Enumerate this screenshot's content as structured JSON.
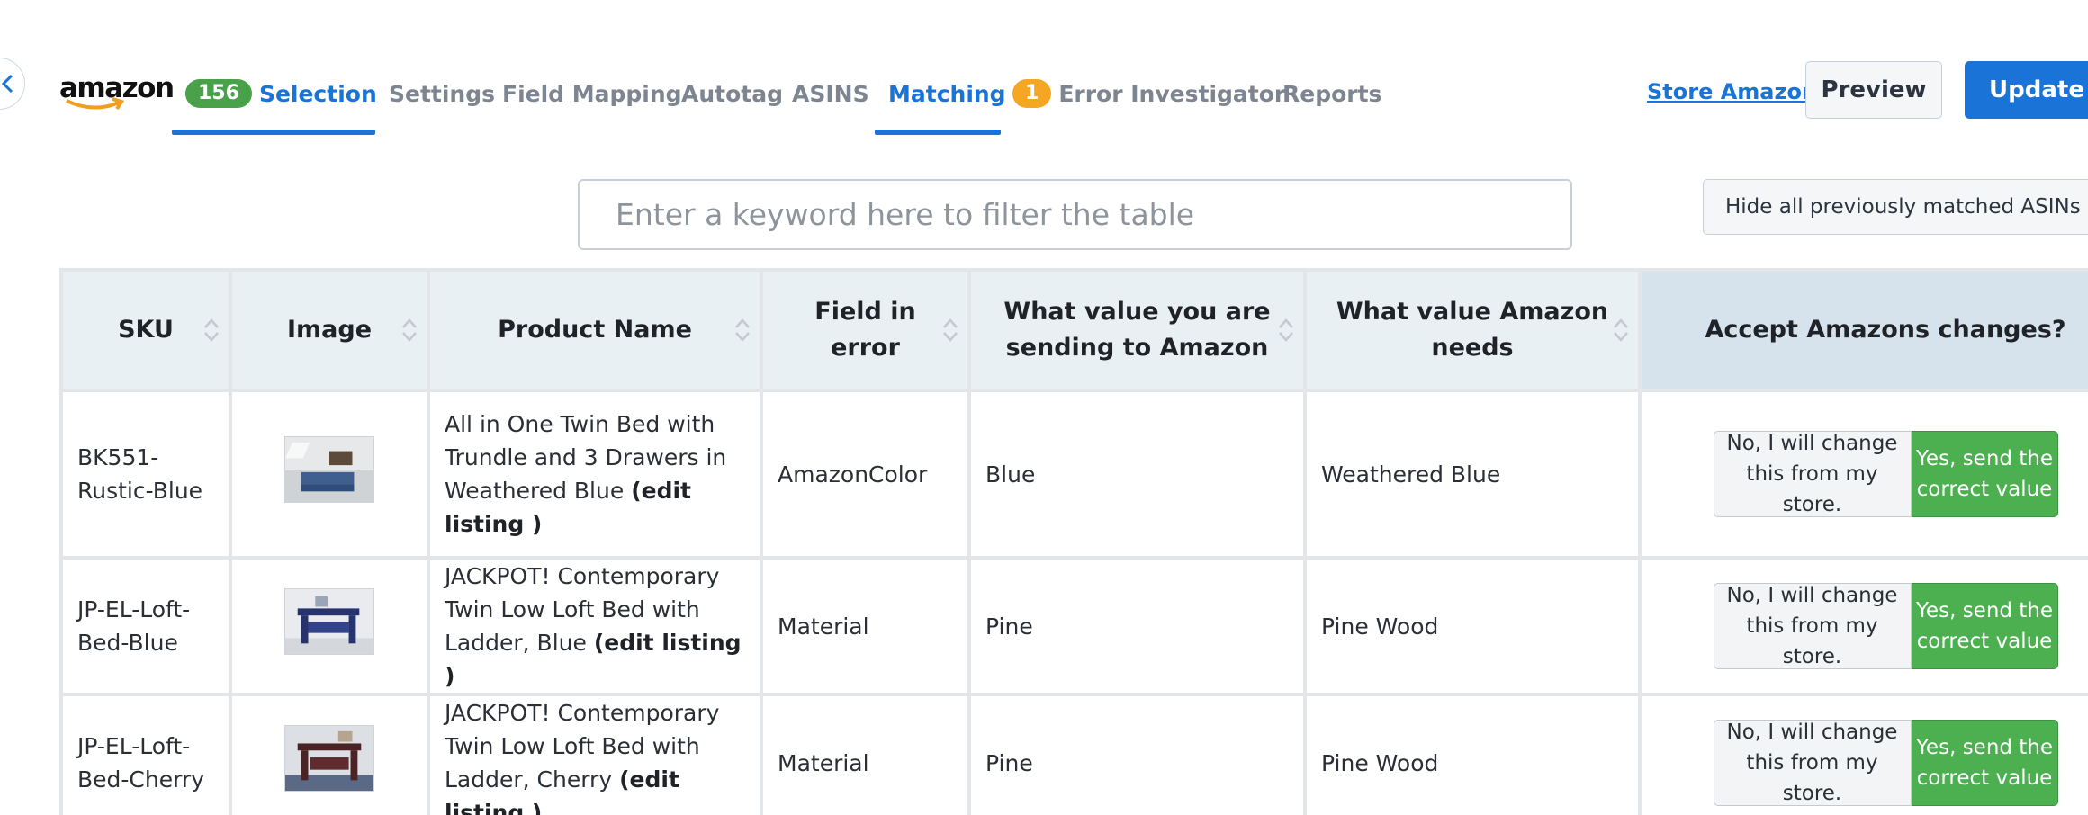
{
  "nav": {
    "items": [
      {
        "label": "Selection",
        "badge": "156",
        "badge_color": "#49a14a",
        "active": true
      },
      {
        "label": "Settings"
      },
      {
        "label": "Field Mapping"
      },
      {
        "label": "Autotag"
      },
      {
        "label": "ASINS"
      },
      {
        "label": "Matching",
        "active": true
      },
      {
        "label": "Error Investigator",
        "badge": "1",
        "badge_color": "#f5a623"
      },
      {
        "label": "Reports"
      }
    ]
  },
  "brand": {
    "logo_text": "amazon"
  },
  "header": {
    "store_link": "Store Amazon",
    "preview_label": "Preview",
    "update_label": "Update"
  },
  "filter": {
    "placeholder": "Enter a keyword here to filter the table",
    "hide_label": "Hide all previously matched ASINs"
  },
  "table": {
    "headers": [
      "SKU",
      "Image",
      "Product Name",
      "Field in error",
      "What value you are sending to Amazon",
      "What value Amazon needs",
      "Accept Amazons changes?"
    ],
    "rows": [
      {
        "sku": "BK551-Rustic-Blue",
        "product_name": "All in One Twin Bed with Trundle and 3 Drawers in Weathered Blue",
        "edit_link": "(edit listing )",
        "field": "AmazonColor",
        "sending": "Blue",
        "needs": "Weathered Blue",
        "no_label": "No, I will change this from my store.",
        "yes_label": "Yes, send the correct value"
      },
      {
        "sku": "JP-EL-Loft-Bed-Blue",
        "product_name": "JACKPOT! Contemporary Twin Low Loft Bed with Ladder, Blue",
        "edit_link": "(edit listing )",
        "field": "Material",
        "sending": "Pine",
        "needs": "Pine Wood",
        "no_label": "No, I will change this from my store.",
        "yes_label": "Yes, send the correct value"
      },
      {
        "sku": "JP-EL-Loft-Bed-Cherry",
        "product_name": "JACKPOT! Contemporary Twin Low Loft Bed with Ladder, Cherry",
        "edit_link": "(edit listing )",
        "field": "Material",
        "sending": "Pine",
        "needs": "Pine Wood",
        "no_label": "No, I will change this from my store.",
        "yes_label": "Yes, send the correct value"
      }
    ]
  },
  "colors": {
    "accent": "#1a73d6",
    "success": "#4caf50",
    "badge_green": "#49a14a",
    "badge_orange": "#f5a623"
  }
}
